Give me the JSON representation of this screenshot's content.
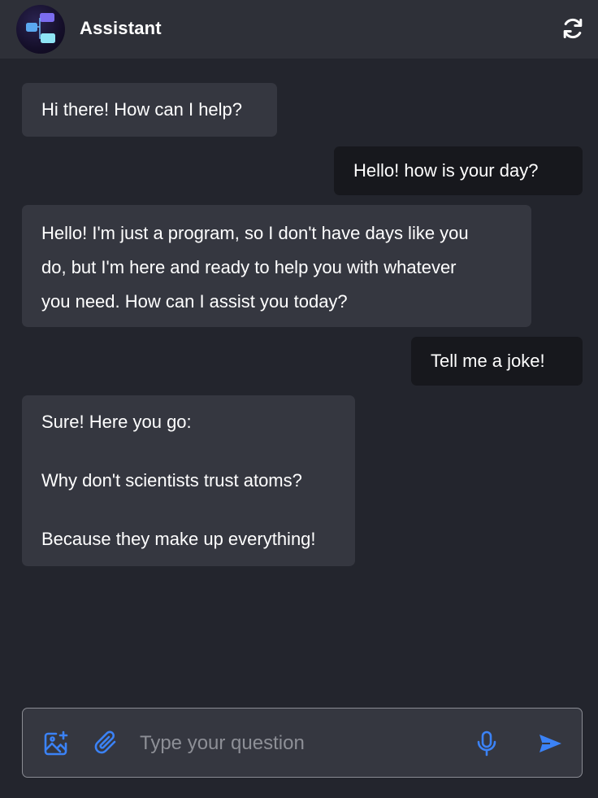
{
  "header": {
    "title": "Assistant",
    "avatar_icon": "app-logo-icon",
    "refresh_icon": "refresh-icon"
  },
  "messages": [
    {
      "role": "assistant",
      "text": "Hi there! How can I help?"
    },
    {
      "role": "user",
      "text": "Hello! how is your day?"
    },
    {
      "role": "assistant",
      "text": "Hello! I'm just a program, so I don't have days like you\ndo, but I'm here and ready to help you with whatever\nyou need. How can I assist you today?"
    },
    {
      "role": "user",
      "text": "Tell me a joke!"
    },
    {
      "role": "assistant",
      "text": "Sure! Here you go:\n\nWhy don't scientists trust atoms?\n\nBecause they make up everything!"
    }
  ],
  "composer": {
    "placeholder": "Type your question",
    "value": "",
    "icons": [
      "add-image-icon",
      "attach-icon",
      "microphone-icon",
      "send-icon"
    ]
  },
  "colors": {
    "background": "#23252d",
    "header": "#2e3038",
    "assistant_bubble": "#353740",
    "user_bubble": "#17181d",
    "accent": "#3b82f6"
  }
}
